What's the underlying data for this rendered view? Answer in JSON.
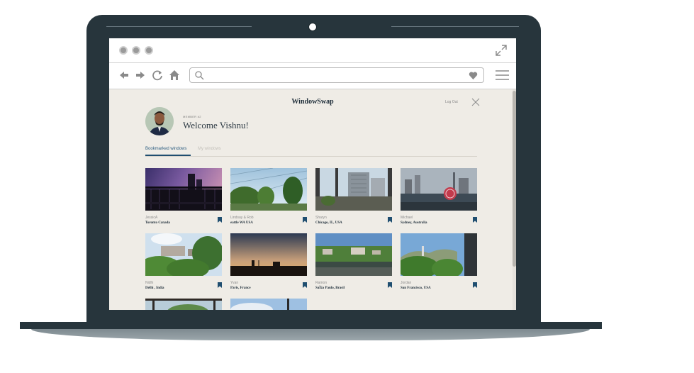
{
  "browser": {
    "search_placeholder": ""
  },
  "page": {
    "brand": "WindowSwap",
    "logout_label": "Log Out",
    "member_label": "MEMBER #2",
    "welcome": "Welcome Vishnu!"
  },
  "tabs": [
    {
      "label": "Bookmarked windows",
      "active": true
    },
    {
      "label": "My windows",
      "active": false
    }
  ],
  "windows": [
    {
      "owner": "JessicA",
      "place": "Toronto Canada",
      "bookmarked": true
    },
    {
      "owner": "Lindsay & Rob",
      "place": "eattle WA USA",
      "bookmarked": true
    },
    {
      "owner": "Sharyn",
      "place": "Chicago, IL, USA",
      "bookmarked": true
    },
    {
      "owner": "Michael",
      "place": "Sydney, Australia",
      "bookmarked": true
    },
    {
      "owner": "Nidhi",
      "place": "Delhi , India",
      "bookmarked": true
    },
    {
      "owner": "Yvan",
      "place": "Paris, France",
      "bookmarked": true
    },
    {
      "owner": "Ramon",
      "place": "SaÌ£o Paulo, Brasil",
      "bookmarked": true
    },
    {
      "owner": "Jordan",
      "place": "San Francisco, USA",
      "bookmarked": true
    }
  ],
  "colors": {
    "laptop_body": "#27353c",
    "page_background": "#efece6",
    "accent": "#1f4e70"
  }
}
